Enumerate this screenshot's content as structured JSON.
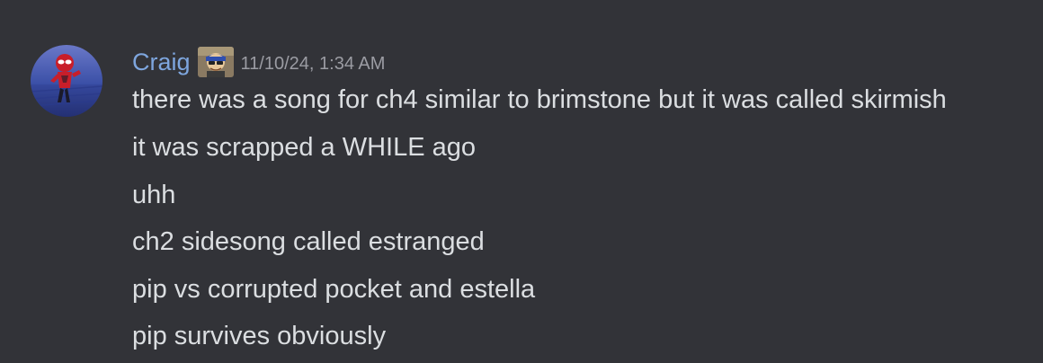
{
  "message": {
    "author": "Craig",
    "timestamp": "11/10/24, 1:34 AM",
    "avatar_icon": "spider-hero-avatar",
    "role_icon": "cartoon-character-role-icon",
    "username_color": "#7ea6de",
    "lines": [
      "there was a song for ch4 similar to brimstone but it was called skirmish",
      "it was scrapped a WHILE ago",
      "uhh",
      "ch2 sidesong called estranged",
      "pip vs corrupted pocket and estella",
      "pip survives obviously"
    ]
  }
}
